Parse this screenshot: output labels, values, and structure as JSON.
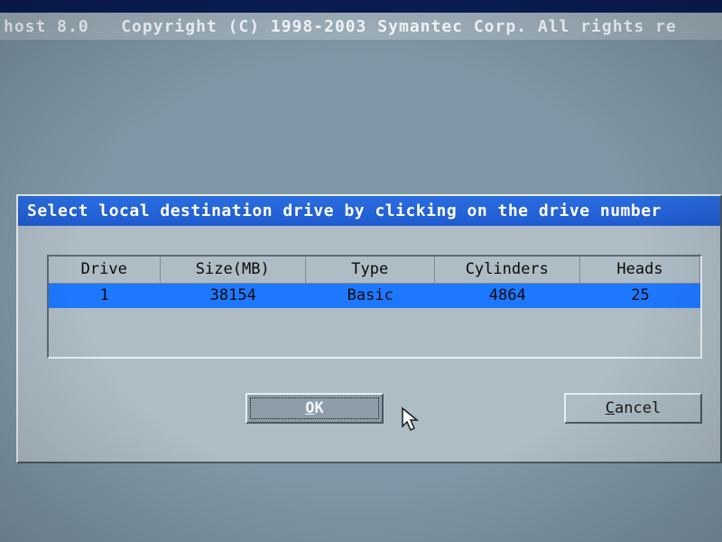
{
  "header": {
    "product": "host 8.0",
    "copyright": "Copyright (C) 1998-2003 Symantec Corp. All rights re"
  },
  "dialog": {
    "title": "Select local destination drive by clicking on the drive number",
    "columns": {
      "drive": "Drive",
      "size": "Size(MB)",
      "type": "Type",
      "cylinders": "Cylinders",
      "heads": "Heads"
    },
    "rows": [
      {
        "drive": "1",
        "size": "38154",
        "type": "Basic",
        "cylinders": "4864",
        "heads": "25"
      }
    ],
    "buttons": {
      "ok_pre": "",
      "ok_mn": "O",
      "ok_post": "K",
      "cancel_pre": "",
      "cancel_mn": "C",
      "cancel_post": "ancel"
    }
  }
}
